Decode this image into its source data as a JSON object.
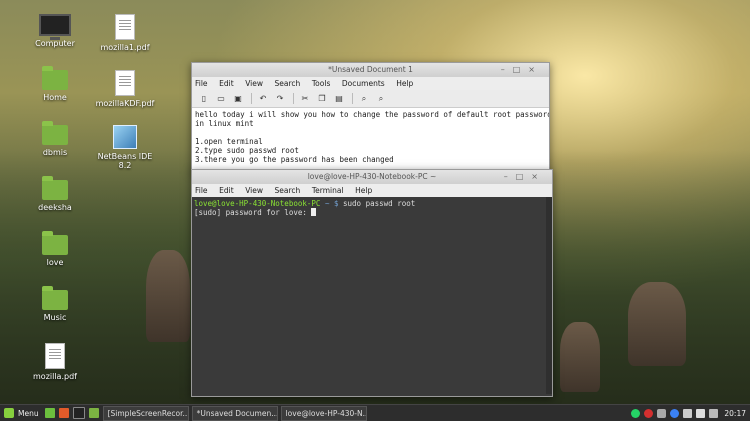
{
  "desktop": {
    "icons_left": [
      {
        "name": "computer-icon",
        "label": "Computer"
      },
      {
        "name": "home-folder-icon",
        "label": "Home"
      },
      {
        "name": "folder-icon",
        "label": "dbmis"
      },
      {
        "name": "folder-icon",
        "label": "deeksha"
      },
      {
        "name": "folder-icon",
        "label": "love"
      },
      {
        "name": "folder-icon",
        "label": "Music"
      },
      {
        "name": "pdf-file-icon",
        "label": "mozilla.pdf"
      }
    ],
    "icons_right": [
      {
        "name": "pdf-file-icon",
        "label": "mozilla1.pdf"
      },
      {
        "name": "pdf-file-icon",
        "label": "mozillaKDF.pdf"
      },
      {
        "name": "netbeans-icon",
        "label": "NetBeans IDE 8.2"
      }
    ]
  },
  "editor_window": {
    "title": "*Unsaved Document 1",
    "menu": [
      "File",
      "Edit",
      "View",
      "Search",
      "Tools",
      "Documents",
      "Help"
    ],
    "lines": [
      "hello today i will show you how to change the password of default root password",
      "in linux mint",
      "",
      "1.open terminal",
      "2.type sudo passwd root",
      "3.there you go the password has been changed"
    ]
  },
  "terminal_window": {
    "title": "love@love-HP-430-Notebook-PC ~",
    "menu": [
      "File",
      "Edit",
      "View",
      "Search",
      "Terminal",
      "Help"
    ],
    "prompt_user": "love@love-HP-430-Notebook-PC",
    "prompt_path": " ~ $",
    "command": " sudo passwd root",
    "line2": "[sudo] password for love: "
  },
  "taskbar": {
    "menu_label": "Menu",
    "tasks": [
      "[SimpleScreenRecor...",
      "*Unsaved Documen...",
      "love@love-HP-430-N..."
    ],
    "clock": "20:17"
  }
}
